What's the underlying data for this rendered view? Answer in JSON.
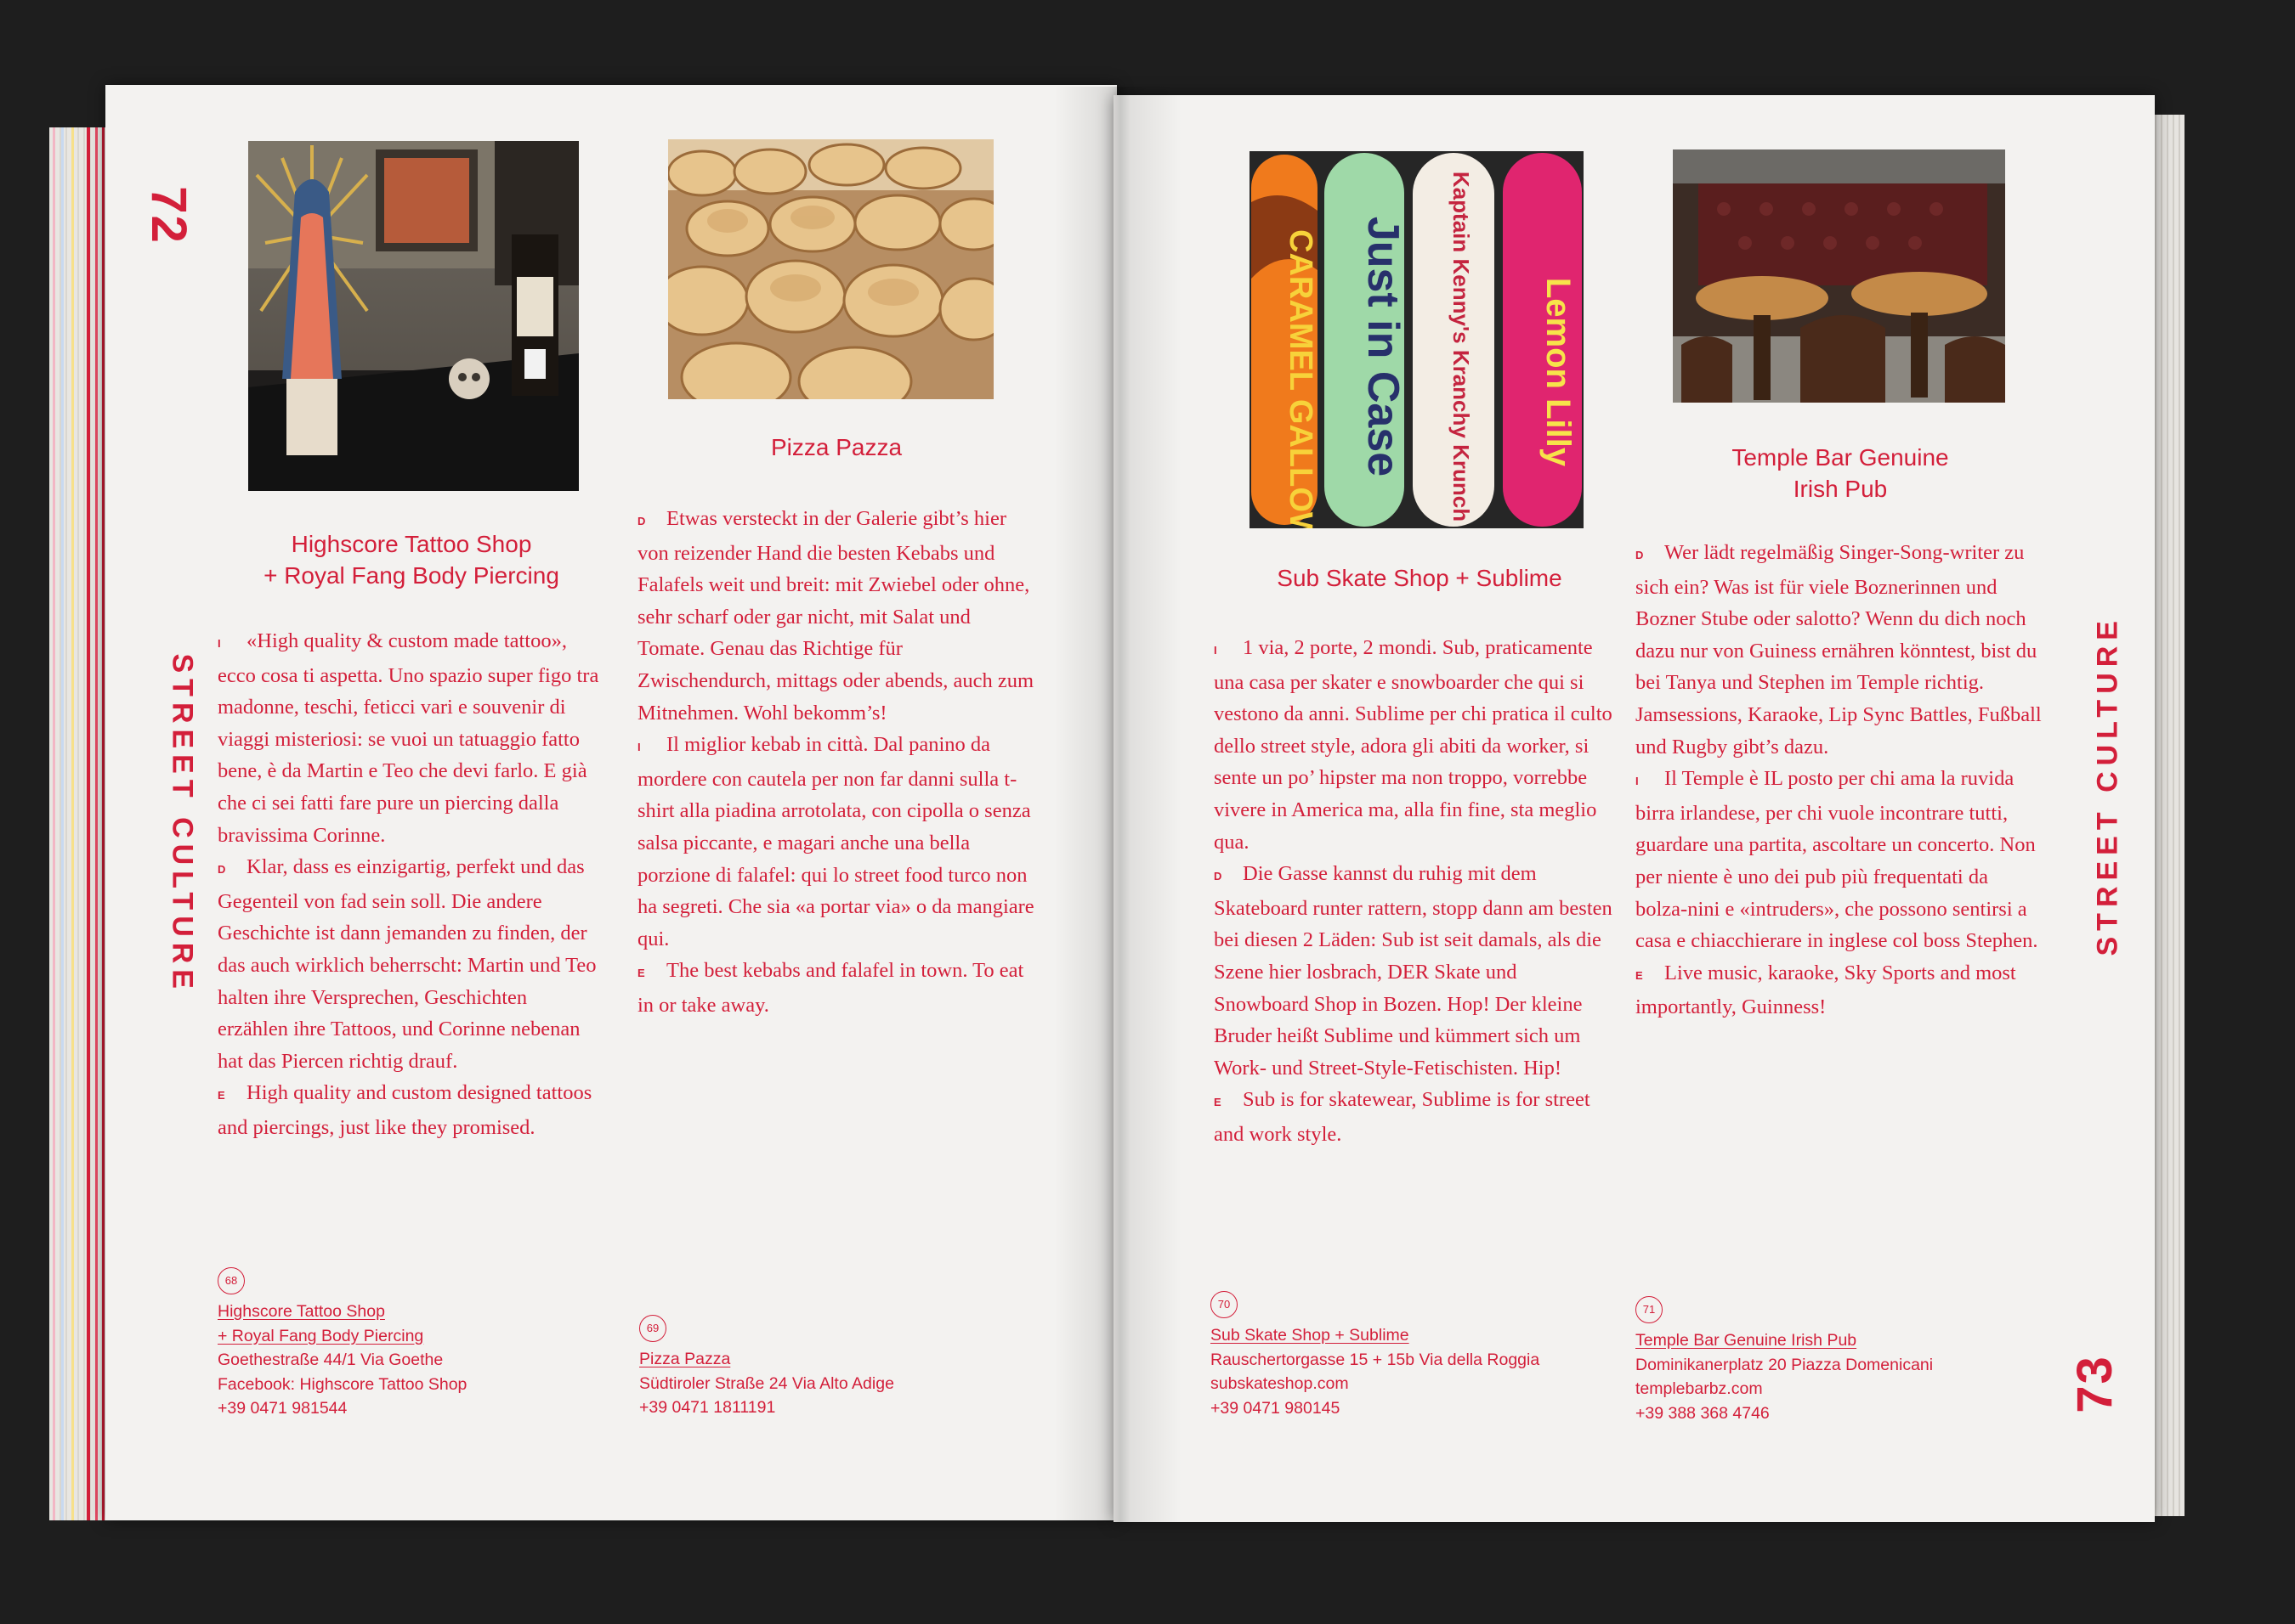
{
  "spread": {
    "left_page_number": "72",
    "right_page_number": "73",
    "left_section": "STREET CULTURE",
    "right_section": "STREET CULTURE"
  },
  "entries": [
    {
      "title_lines": [
        "Highscore Tattoo Shop",
        "+ Royal Fang Body Piercing"
      ],
      "paragraphs": [
        {
          "lang": "I",
          "text": "«High quality & custom made tattoo», ecco cosa ti aspetta. Uno spazio super figo tra madonne, teschi, feticci vari e souvenir di viaggi misteriosi: se vuoi un tatuaggio fatto bene, è da Martin e Teo che devi farlo. E già che ci sei fatti fare pure un piercing dalla bravissima Corinne."
        },
        {
          "lang": "D",
          "text": "Klar, dass es einzigartig, perfekt und das Gegenteil von fad sein soll. Die andere Geschichte ist dann jemanden zu finden, der das auch wirklich beherrscht: Martin und Teo halten ihre Versprechen, Geschichten erzählen ihre Tattoos, und Corinne nebenan hat das Piercen richtig drauf."
        },
        {
          "lang": "E",
          "text": "High quality and custom designed tattoos and piercings, just like they promised."
        }
      ],
      "info": {
        "number": "68",
        "name_lines": [
          "Highscore Tattoo Shop",
          "+ Royal Fang Body Piercing"
        ],
        "address": "Goethestraße  44/1  Via Goethe",
        "web": "Facebook: Highscore Tattoo Shop",
        "phone": "+39 0471 981544"
      }
    },
    {
      "title_lines": [
        "Pizza Pazza"
      ],
      "paragraphs": [
        {
          "lang": "D",
          "text": "Etwas versteckt in der Galerie gibt’s hier von reizender Hand die besten Kebabs und Falafels weit und breit: mit Zwiebel oder ohne, sehr scharf oder gar nicht, mit Salat und Tomate. Genau das Richtige für Zwischendurch, mittags oder abends, auch zum Mitnehmen. Wohl bekomm’s!"
        },
        {
          "lang": "I",
          "text": "Il miglior kebab in città. Dal panino da mordere con cautela per non far danni sulla t-shirt alla piadina arrotolata, con cipolla o senza salsa piccante, e magari anche una bella porzione di falafel: qui lo street food turco non ha segreti. Che sia «a portar via» o da mangiare qui."
        },
        {
          "lang": "E",
          "text": "The best kebabs and falafel in town. To eat in or take away."
        }
      ],
      "info": {
        "number": "69",
        "name_lines": [
          "Pizza Pazza"
        ],
        "address": "Südtiroler Straße  24  Via Alto Adige",
        "web": "",
        "phone": "+39 0471 1811191"
      }
    },
    {
      "title_lines": [
        "Sub Skate Shop + Sublime"
      ],
      "paragraphs": [
        {
          "lang": "I",
          "text": "1 via, 2 porte, 2 mondi. Sub, praticamente una casa per skater e snowboarder che qui si vestono da anni. Sublime per chi pratica il culto dello street style, adora gli abiti da worker, si sente un po’ hipster ma non troppo, vorrebbe vivere in America ma, alla fin fine, sta meglio qua."
        },
        {
          "lang": "D",
          "text": "Die Gasse kannst du ruhig mit dem Skateboard runter rattern, stopp dann am besten bei diesen 2 Läden: Sub ist seit damals, als die Szene hier losbrach, DER Skate und Snowboard Shop in Bozen. Hop! Der kleine Bruder heißt Sublime und kümmert sich um Work- und Street-Style-Fetischisten. Hip!"
        },
        {
          "lang": "E",
          "text": "Sub is for skatewear, Sublime is for street and work style."
        }
      ],
      "info": {
        "number": "70",
        "name_lines": [
          "Sub Skate Shop + Sublime"
        ],
        "address": "Rauschertorgasse  15 + 15b  Via della Roggia",
        "web": "subskateshop.com",
        "phone": "+39 0471 980145"
      }
    },
    {
      "title_lines": [
        "Temple Bar Genuine",
        "Irish Pub"
      ],
      "paragraphs": [
        {
          "lang": "D",
          "text": "Wer lädt regelmäßig Singer-Song-writer zu sich ein? Was ist für viele Boznerinnen und Bozner Stube oder salotto? Wenn du dich noch dazu nur von Guiness ernähren könntest, bist du bei Tanya und Stephen im Temple richtig. Jamsessions, Karaoke, Lip Sync Battles, Fußball und Rugby gibt’s dazu."
        },
        {
          "lang": "I",
          "text": "Il Temple è IL posto per chi ama la ruvida birra irlandese, per chi vuole incontrare tutti, guardare una partita, ascoltare un concerto. Non per niente è uno dei pub più frequentati da bolza-nini e «intruders», che possono sentirsi a casa e chiacchierare in inglese col boss Stephen."
        },
        {
          "lang": "E",
          "text": "Live music, karaoke, Sky Sports and most importantly, Guinness!"
        }
      ],
      "info": {
        "number": "71",
        "name_lines": [
          "Temple Bar Genuine Irish Pub"
        ],
        "address": "Dominikanerplatz  20  Piazza Domenicani",
        "web": "templebarbz.com",
        "phone": "+39 388 368 4746"
      }
    }
  ],
  "photos": {
    "skateboards": [
      {
        "text": "CARAMEL GALLOWAY",
        "base": "#f07a1c"
      },
      {
        "text": "Just in Case",
        "base": "#9fd9a8"
      },
      {
        "text": "Kaptain Kenny's Kranchy Krunch",
        "base": "#f3ede4"
      },
      {
        "text": "Lemon Lilly",
        "base": "#e0256f"
      }
    ]
  },
  "colors": {
    "accent": "#d31f3a",
    "paper": "#f3f2f0",
    "background": "#1e1e1e"
  }
}
